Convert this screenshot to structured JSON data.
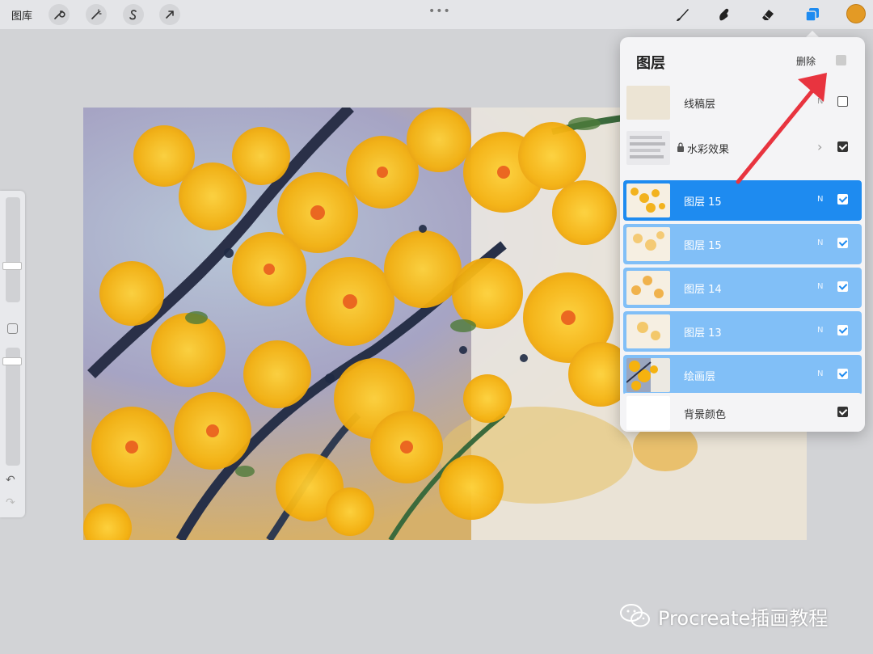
{
  "toolbar": {
    "gallery_label": "图库",
    "left_tools": [
      {
        "name": "actions-wrench-icon"
      },
      {
        "name": "adjustments-wand-icon"
      },
      {
        "name": "selection-s-icon"
      },
      {
        "name": "transform-arrow-icon"
      }
    ],
    "grabber_glyph": "•••",
    "right_tools": [
      {
        "name": "brush-icon"
      },
      {
        "name": "smudge-icon"
      },
      {
        "name": "eraser-icon"
      },
      {
        "name": "layers-icon"
      }
    ],
    "current_color": "#e39a25"
  },
  "sidebar": {
    "undo_glyph": "↶",
    "redo_glyph": "↷"
  },
  "layers_panel": {
    "title": "图层",
    "delete_label": "删除",
    "layers": [
      {
        "name": "线稿层",
        "blend": "N",
        "visible": false,
        "state": "normal",
        "thumb": "sketch"
      },
      {
        "name": "水彩效果",
        "blend": "",
        "visible": true,
        "state": "normal",
        "thumb": "watercolor",
        "locked": true,
        "group": true
      },
      {
        "name": "图层 15",
        "blend": "N",
        "visible": true,
        "state": "active",
        "thumb": "flowers1"
      },
      {
        "name": "图层 15",
        "blend": "N",
        "visible": true,
        "state": "selected",
        "thumb": "flowers2"
      },
      {
        "name": "图层 14",
        "blend": "N",
        "visible": true,
        "state": "selected",
        "thumb": "flowers3"
      },
      {
        "name": "图层 13",
        "blend": "N",
        "visible": true,
        "state": "selected",
        "thumb": "flowers4"
      },
      {
        "name": "绘画层",
        "blend": "N",
        "visible": true,
        "state": "selected",
        "thumb": "painting"
      },
      {
        "name": "背景颜色",
        "blend": "",
        "visible": true,
        "state": "normal",
        "thumb": "background"
      }
    ]
  },
  "watermark": {
    "text": "Procreate插画教程"
  },
  "colors": {
    "active_layer": "#1e8bf0",
    "selected_layer": "#81bff7",
    "annotation_arrow": "#e8343f"
  }
}
